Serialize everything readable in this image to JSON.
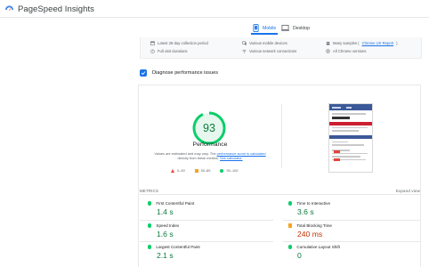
{
  "app": {
    "title": "PageSpeed Insights"
  },
  "tabs": {
    "mobile": "Mobile",
    "desktop": "Desktop"
  },
  "info": {
    "row1": {
      "col1": "Latest 28-day collection period",
      "col2": "Various mobile devices",
      "col3_prefix": "Many samples (",
      "col3_link": "Chrome UX Report",
      "col3_suffix": ")"
    },
    "row2": {
      "col1": "Full visit durations",
      "col2": "Various network connections",
      "col3": "All Chrome versions"
    }
  },
  "diagnose": {
    "title": "Diagnose performance issues"
  },
  "performance": {
    "score": "93",
    "label": "Performance",
    "desc_prefix": "Values are estimated and may vary. The ",
    "desc_link1": "performance score is calculated",
    "desc_mid": " directly from these metrics. ",
    "desc_link2": "See calculator.",
    "legend": {
      "bad": "0–49",
      "avg": "50–89",
      "good": "90–100"
    },
    "score_fraction": 0.93
  },
  "metrics": {
    "header": "METRICS",
    "expand": "Expand view",
    "fcp": {
      "label": "First Contentful Paint",
      "value": "1.4 s"
    },
    "tti": {
      "label": "Time to Interactive",
      "value": "3.6 s"
    },
    "si": {
      "label": "Speed Index",
      "value": "1.6 s"
    },
    "tbt": {
      "label": "Total Blocking Time",
      "value": "240 ms"
    },
    "lcp": {
      "label": "Largest Contentful Paint",
      "value": "2.1 s"
    },
    "cls": {
      "label": "Cumulative Layout Shift",
      "value": "0"
    }
  },
  "colors": {
    "accent": "#1a73e8",
    "good": "#0cce6b",
    "average": "#f8a324",
    "poor": "#e8413b"
  }
}
